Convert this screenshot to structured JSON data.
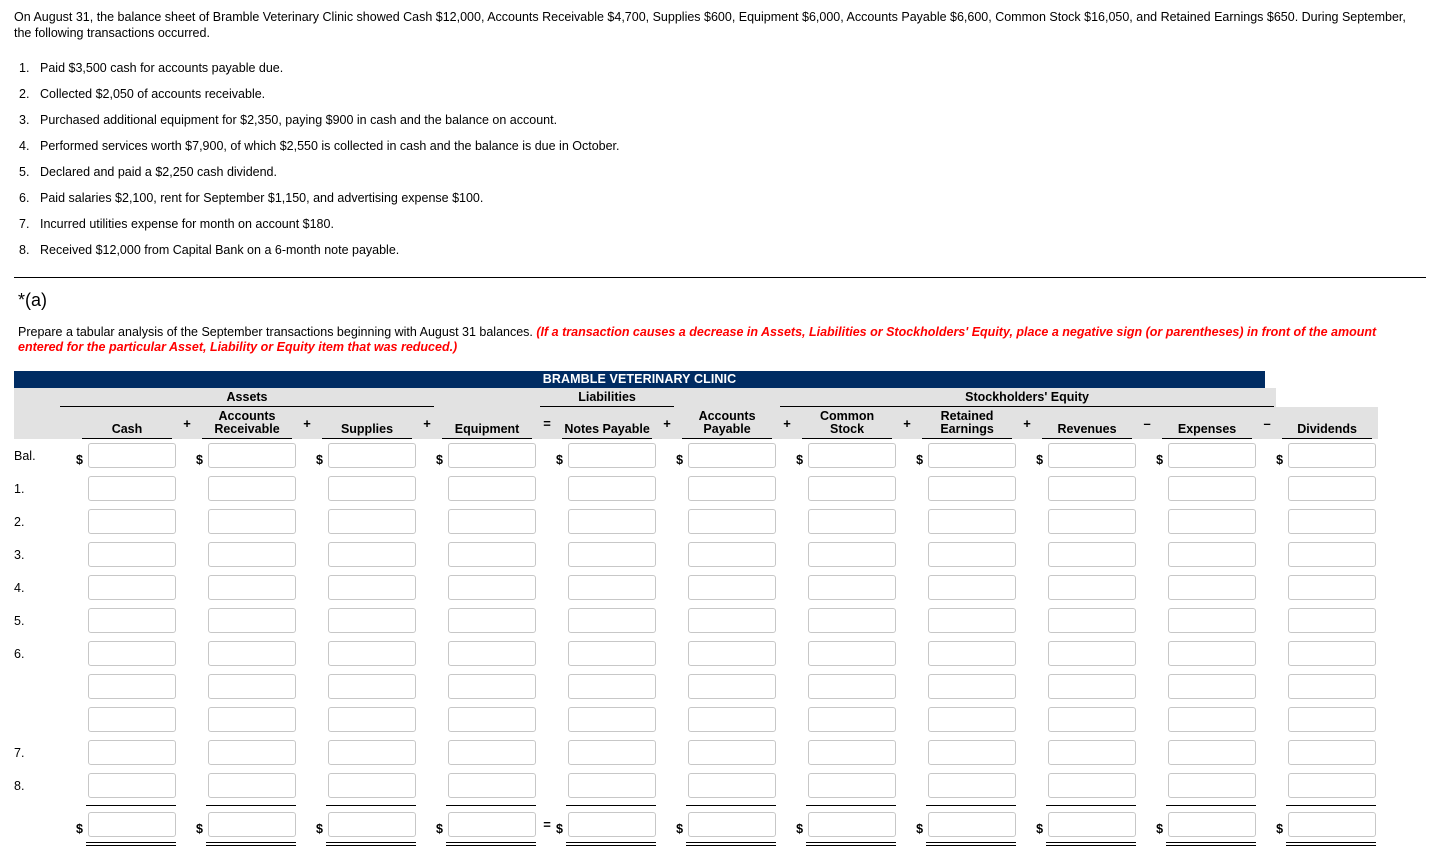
{
  "intro": "On August 31, the balance sheet of Bramble Veterinary Clinic showed Cash $12,000, Accounts Receivable $4,700, Supplies $600, Equipment $6,000, Accounts Payable $6,600, Common Stock $16,050, and Retained Earnings $650. During September, the following transactions occurred.",
  "transactions": [
    {
      "num": "1.",
      "text": "Paid $3,500 cash for accounts payable due."
    },
    {
      "num": "2.",
      "text": "Collected $2,050 of accounts receivable."
    },
    {
      "num": "3.",
      "text": "Purchased additional equipment for $2,350, paying $900 in cash and the balance on account."
    },
    {
      "num": "4.",
      "text": "Performed services worth $7,900, of which $2,550 is collected in cash and the balance is due in October."
    },
    {
      "num": "5.",
      "text": "Declared and paid a $2,250 cash dividend."
    },
    {
      "num": "6.",
      "text": "Paid salaries $2,100, rent for September $1,150, and advertising expense $100."
    },
    {
      "num": "7.",
      "text": "Incurred utilities expense for month on account $180."
    },
    {
      "num": "8.",
      "text": "Received $12,000 from Capital Bank on a 6-month note payable."
    }
  ],
  "section": {
    "label": "*(a)",
    "prompt_plain": "Prepare a tabular analysis of the September transactions beginning with August 31 balances. ",
    "prompt_red": "(If a transaction causes a decrease in Assets, Liabilities or Stockholders' Equity, place a negative sign (or parentheses) in front of the amount entered for the particular Asset, Liability or Equity item that was reduced.)"
  },
  "worksheet": {
    "title": "BRAMBLE VETERINARY CLINIC",
    "groups": [
      {
        "label": "Assets",
        "span": 7
      },
      {
        "label": "Liabilities",
        "span": 3
      },
      {
        "label": "Stockholders' Equity",
        "span": 9
      }
    ],
    "columns": [
      {
        "label": "Cash",
        "op_before": ""
      },
      {
        "label": "Accounts Receivable",
        "op_before": "+"
      },
      {
        "label": "Supplies",
        "op_before": "+"
      },
      {
        "label": "Equipment",
        "op_before": "+"
      },
      {
        "label": "Notes Payable",
        "op_before": "="
      },
      {
        "label": "Accounts Payable",
        "op_before": "+"
      },
      {
        "label": "Common Stock",
        "op_before": "+"
      },
      {
        "label": "Retained Earnings",
        "op_before": "+"
      },
      {
        "label": "Revenues",
        "op_before": "+"
      },
      {
        "label": "Expenses",
        "op_before": "–"
      },
      {
        "label": "Dividends",
        "op_before": "–"
      }
    ],
    "rows": [
      {
        "label": "Bal.",
        "dollar": true
      },
      {
        "label": "1.",
        "dollar": false
      },
      {
        "label": "2.",
        "dollar": false
      },
      {
        "label": "3.",
        "dollar": false
      },
      {
        "label": "4.",
        "dollar": false
      },
      {
        "label": "5.",
        "dollar": false
      },
      {
        "label": "6.",
        "dollar": false
      },
      {
        "label": "",
        "dollar": false
      },
      {
        "label": "",
        "dollar": false
      },
      {
        "label": "7.",
        "dollar": false
      },
      {
        "label": "8.",
        "dollar": false
      }
    ],
    "total_row": {
      "label": "",
      "dollar": true
    },
    "cell_placeholder": "",
    "colors": {
      "title_bar": "#002c63",
      "header_band": "#e2e2e2",
      "box_border": "#c7c7c7",
      "emphasis": "#ff0000"
    }
  }
}
